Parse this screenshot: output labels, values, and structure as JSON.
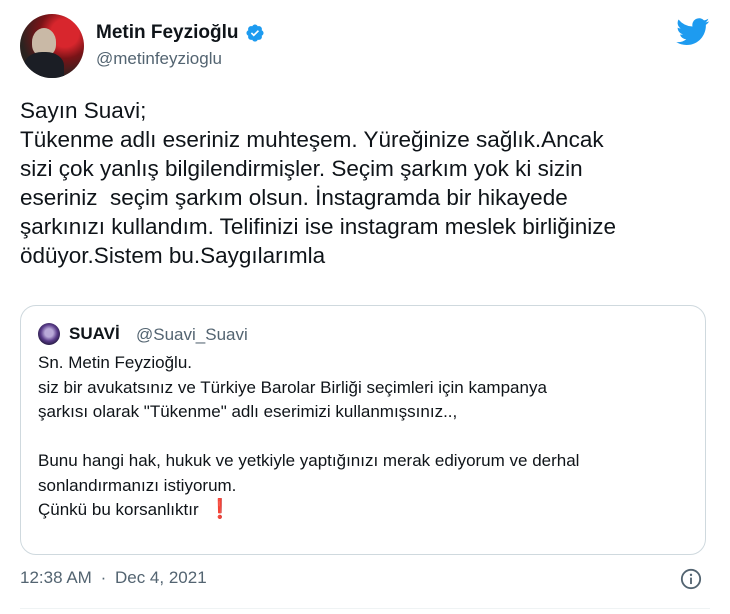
{
  "author": {
    "display_name": "Metin Feyzioğlu",
    "handle": "@metinfeyzioglu",
    "verified_icon": "verified-badge-icon"
  },
  "tweet": {
    "lines": [
      "Sayın Suavi;",
      "Tükenme adlı eseriniz muhteşem. Yüreğinize sağlık.Ancak",
      "sizi çok yanlış bilgilendirmişler. Seçim şarkım yok ki sizin",
      "eseriniz  seçim şarkım olsun. İnstagramda bir hikayede",
      "şarkınızı kullandım. Telifinizi ise instagram meslek birliğinize",
      "ödüyor.Sistem bu.Saygılarımla"
    ]
  },
  "quoted": {
    "display_name": "SUAVİ",
    "handle": "@Suavi_Suavi",
    "lines": [
      "Sn. Metin Feyzioğlu.",
      "siz bir avukatsınız ve Türkiye Barolar Birliği seçimleri için kampanya",
      "şarkısı olarak \"Tükenme\" adlı eserimizi kullanmışsınız..,",
      "",
      "Bunu hangi hak, hukuk ve yetkiyle yaptığınızı merak ediyorum ve derhal",
      "sonlandırmanızı istiyorum.",
      "Çünkü bu korsanlıktır"
    ],
    "exclamation": "❗"
  },
  "meta": {
    "time": "12:38 AM",
    "separator": "·",
    "date": "Dec 4, 2021"
  },
  "colors": {
    "text": "#0f1419",
    "secondary": "#536471",
    "twitter_blue": "#1d9bf0",
    "border": "#cfd9de",
    "exclamation": "#d0021b"
  },
  "icons": [
    "twitter-bird-icon",
    "verified-badge-icon",
    "info-icon"
  ]
}
